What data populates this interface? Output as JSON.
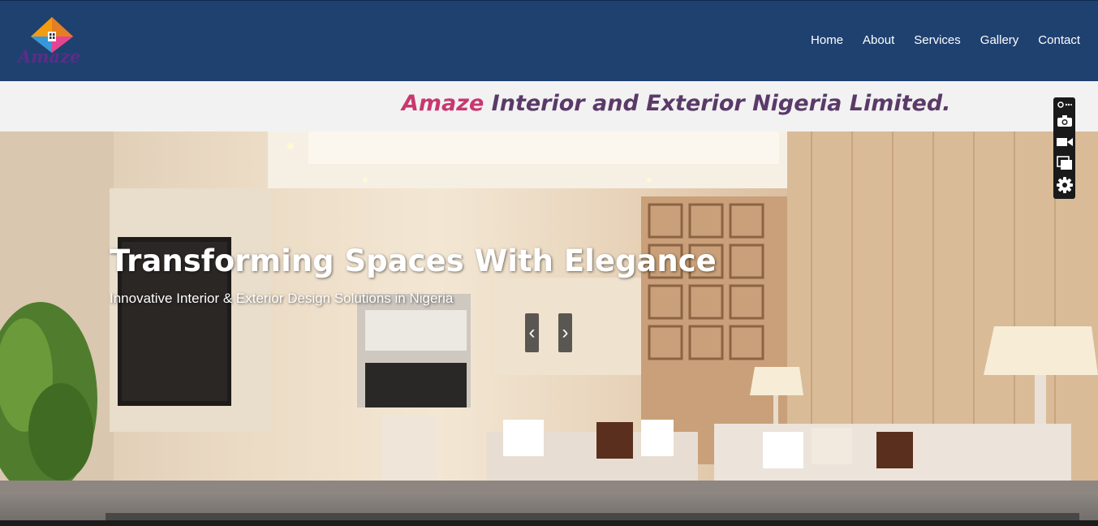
{
  "header": {
    "logo_text": "Amaze",
    "nav": [
      {
        "label": "Home"
      },
      {
        "label": "About"
      },
      {
        "label": "Services"
      },
      {
        "label": "Gallery"
      },
      {
        "label": "Contact"
      }
    ]
  },
  "tagline": {
    "brand": "Amaze",
    "rest": " Interior and Exterior Nigeria Limited."
  },
  "hero": {
    "title": "Transforming Spaces With Elegance",
    "subtitle": "Innovative Interior & Exterior Design Solutions in Nigeria",
    "prev_label": "‹",
    "next_label": "›"
  },
  "toolbar": {
    "icons": [
      "pin-more-icon",
      "camera-icon",
      "video-icon",
      "window-stack-icon",
      "gear-icon"
    ]
  },
  "colors": {
    "nav_bg": "#1f4170",
    "brand_pink": "#c8386f",
    "brand_purple": "#5a3a68",
    "tagline_bg": "#f2f2f2"
  }
}
